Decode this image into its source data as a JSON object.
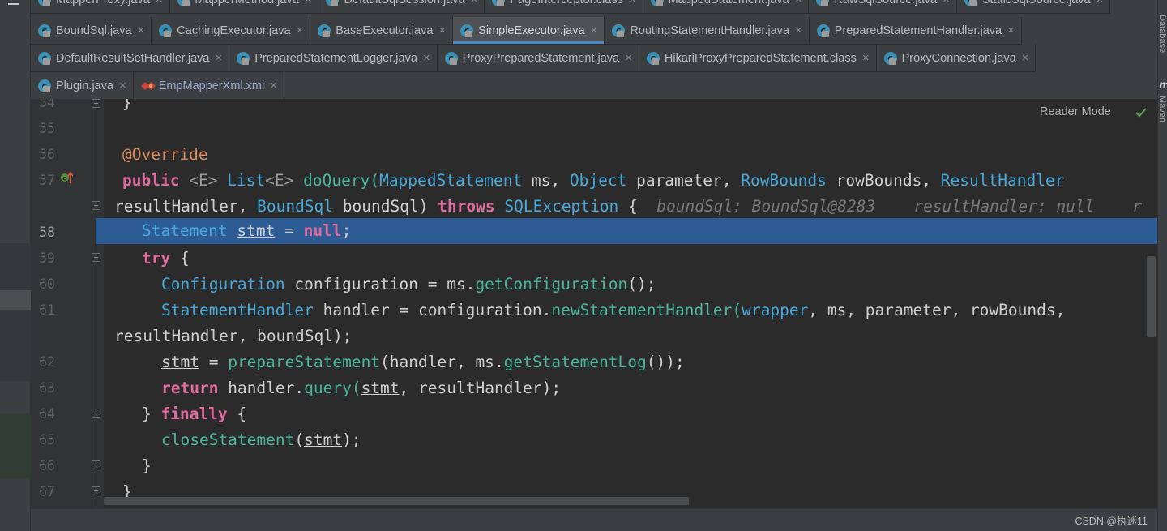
{
  "editor_tabs": {
    "row1": [
      {
        "label": "MapperProxy.java",
        "type": "class"
      },
      {
        "label": "MapperMethod.java",
        "type": "class"
      },
      {
        "label": "DefaultSqlSession.java",
        "type": "class"
      },
      {
        "label": "PageInterceptor.class",
        "type": "class"
      },
      {
        "label": "MappedStatement.java",
        "type": "class"
      },
      {
        "label": "RawSqlSource.java",
        "type": "class"
      },
      {
        "label": "StaticSqlSource.java",
        "type": "class"
      }
    ],
    "row2": [
      {
        "label": "BoundSql.java",
        "type": "class"
      },
      {
        "label": "CachingExecutor.java",
        "type": "class"
      },
      {
        "label": "BaseExecutor.java",
        "type": "class"
      },
      {
        "label": "SimpleExecutor.java",
        "type": "class",
        "active": true
      },
      {
        "label": "RoutingStatementHandler.java",
        "type": "class"
      },
      {
        "label": "PreparedStatementHandler.java",
        "type": "class"
      }
    ],
    "row3": [
      {
        "label": "DefaultResultSetHandler.java",
        "type": "class"
      },
      {
        "label": "PreparedStatementLogger.java",
        "type": "class"
      },
      {
        "label": "ProxyPreparedStatement.java",
        "type": "class"
      },
      {
        "label": "HikariProxyPreparedStatement.class",
        "type": "class"
      },
      {
        "label": "ProxyConnection.java",
        "type": "class"
      }
    ],
    "row4": [
      {
        "label": "Plugin.java",
        "type": "class"
      },
      {
        "label": "EmpMapperXml.xml",
        "type": "xml"
      }
    ],
    "close_glyph": "×"
  },
  "editor": {
    "reader_mode_label": "Reader Mode",
    "current_line": "58",
    "line_numbers": [
      "54",
      "55",
      "56",
      "57",
      "",
      "58",
      "59",
      "60",
      "61",
      "",
      "62",
      "63",
      "64",
      "65",
      "66",
      "67"
    ],
    "code": {
      "l54": "}",
      "l56_annotation": "@Override",
      "l57": {
        "public": "public",
        "tparam_open": "<E>",
        "list": "List",
        "list_generic": "<E>",
        "method": "doQuery",
        "paren_open": "(",
        "type1": "MappedStatement",
        "arg1": " ms, ",
        "type2": "Object",
        "arg2": " parameter, ",
        "type3": "RowBounds",
        "arg3": " rowBounds, ",
        "type4": "ResultHandler"
      },
      "l57_cont": {
        "arg4": "resultHandler, ",
        "type5": "BoundSql",
        "arg5": " boundSql) ",
        "throws": "throws",
        "exception": "SQLException",
        "brace": " {",
        "hint1": "boundSql: BoundSql@8283",
        "hint2": "resultHandler: null",
        "hint3": "r"
      },
      "l58": {
        "type": "Statement",
        "var": "stmt",
        "eq": " = ",
        "null_kw": "null",
        "end": ";"
      },
      "l59": {
        "kw": "try",
        "rest": " {"
      },
      "l60": {
        "type": "Configuration",
        "rest1": " configuration = ms.",
        "method": "getConfiguration",
        "rest2": "();"
      },
      "l61": {
        "type": "StatementHandler",
        "rest1": " handler = configuration.",
        "method": "newStatementHandler",
        "paren": "(",
        "field": "wrapper",
        "rest2": ", ms, parameter, rowBounds,"
      },
      "l61_cont": "resultHandler, boundSql);",
      "l62": {
        "var": "stmt",
        "rest1": " = ",
        "method1": "prepareStatement",
        "rest2": "(handler, ms.",
        "method2": "getStatementLog",
        "rest3": "());"
      },
      "l63": {
        "kw": "return",
        "rest1": " handler.",
        "method": "query",
        "paren": "(",
        "var": "stmt",
        "rest2": ", resultHandler);"
      },
      "l64": {
        "pre": "} ",
        "kw": "finally",
        "rest": " {"
      },
      "l65": {
        "method": "closeStatement",
        "paren": "(",
        "var": "stmt",
        "rest": ");"
      },
      "l66": "}",
      "l67": "}"
    }
  },
  "right_panel": {
    "database_label": "Database",
    "maven_label": "Maven",
    "maven_glyph": "m"
  },
  "status": {
    "watermark": "CSDN @执迷11"
  },
  "colors": {
    "background": "#2b2b2b",
    "gutter": "#313335",
    "current_line_highlight": "#2d5c94",
    "keyword": "#e06c9f",
    "type": "#47a8d9",
    "method": "#4bb59b",
    "annotation": "#d98a5c"
  }
}
